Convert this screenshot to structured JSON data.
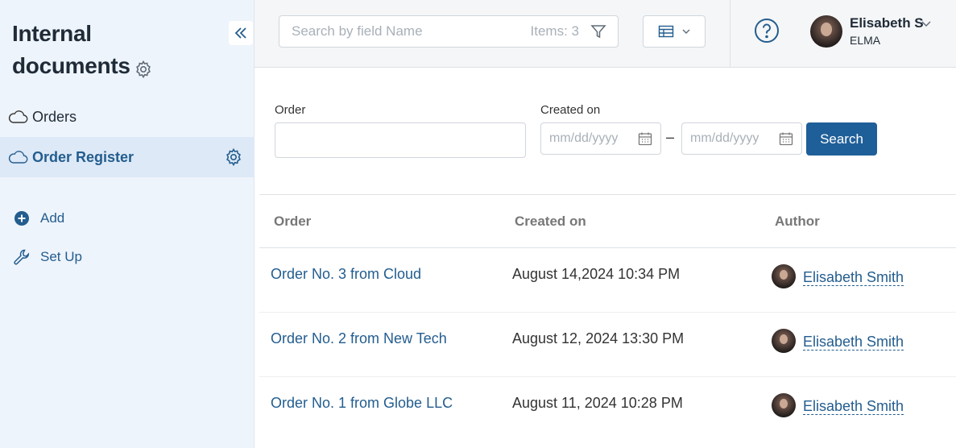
{
  "sidebar": {
    "title_line1": "Internal",
    "title_line2": "documents",
    "items": [
      {
        "label": "Orders"
      },
      {
        "label": "Order Register"
      }
    ],
    "actions": {
      "add_label": "Add",
      "setup_label": "Set Up"
    }
  },
  "topbar": {
    "search_placeholder": "Search by field Name",
    "items_count": "Items: 3",
    "user": {
      "name": "Elisabeth S",
      "org": "ELMA"
    }
  },
  "filters": {
    "order_label": "Order",
    "created_label": "Created on",
    "date_placeholder_from": "mm/dd/yyyy",
    "date_placeholder_to": "mm/dd/yyyy",
    "dash": "–",
    "search_button": "Search"
  },
  "table": {
    "columns": [
      "Order",
      "Created on",
      "Author"
    ],
    "rows": [
      {
        "order": "Order No. 3 from Cloud",
        "created": "August 14,2024 10:34 PM",
        "author": "Elisabeth Smith"
      },
      {
        "order": "Order No. 2 from New Tech",
        "created": "August 12, 2024 13:30 PM",
        "author": "Elisabeth Smith"
      },
      {
        "order": "Order No. 1 from Globe LLC",
        "created": "August 11, 2024 10:28 PM",
        "author": "Elisabeth Smith"
      }
    ]
  },
  "colors": {
    "accent": "#235d8f",
    "button": "#1f5f99",
    "sidebar_bg": "#eef4fb",
    "sidebar_active": "#dde9f6"
  },
  "icons": [
    "double-chevron-left-icon",
    "gear-icon",
    "cloud-icon",
    "plus-circle-icon",
    "wrench-icon",
    "filter-icon",
    "table-view-icon",
    "chevron-down-icon",
    "help-icon",
    "calendar-icon",
    "avatar"
  ]
}
